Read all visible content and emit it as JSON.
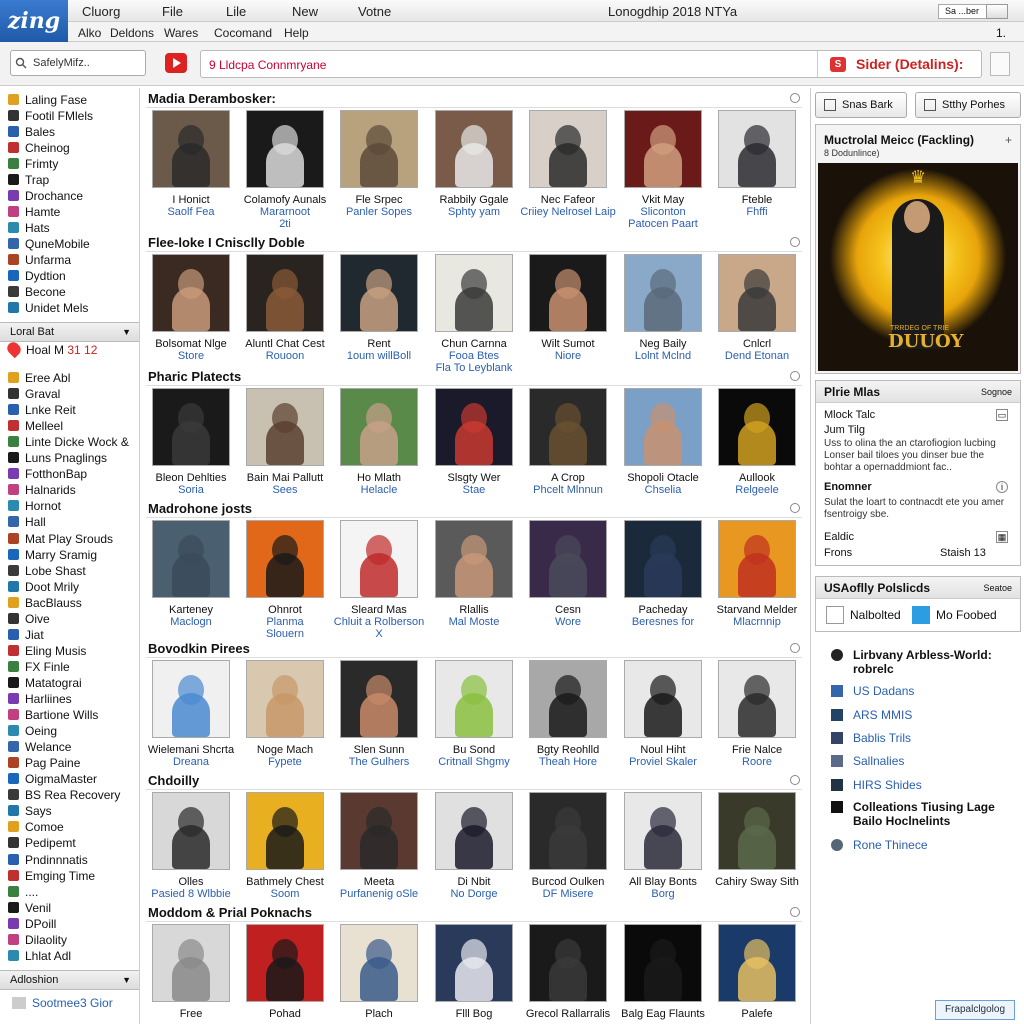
{
  "app": {
    "logo": "zing",
    "window_title": "Lonogdhip 2018 NTYa"
  },
  "titlebar": {
    "menus": [
      "Cluorg",
      "File",
      "Lile",
      "New",
      "Votne"
    ],
    "search_value": "Sa ...ber"
  },
  "menubar": {
    "items": [
      "Alko",
      "Deldons",
      "Wares",
      "Cocomand",
      "Help"
    ],
    "page_indicator": "1."
  },
  "toolbar": {
    "search_placeholder": "SafelyMifz..",
    "url": "9 Lldcpa Connmryane",
    "sider_label": "Sider (Detalins):"
  },
  "sidebar": {
    "items_a": [
      "Laling Fase",
      "Footil FMlels",
      "Bales",
      "Cheinog",
      "Frimty",
      "Trap",
      "Drochance",
      "Hamte",
      "Hats",
      "QuneMobile",
      "Unfarma",
      "Dydtion",
      "Becone",
      "Unidet Mels"
    ],
    "local_header": "Loral Bat",
    "hot_label": "Hoal M",
    "hot_count": "31 12",
    "items_b": [
      "Eree Abl",
      "Graval",
      "Lnke Reit",
      "Melleel",
      "Linte Dicke Wock &",
      "Luns Pnaglings",
      "FotthonBap",
      "Halnarids",
      "Hornot",
      "Hall",
      "Mat Play Srouds",
      "Marry Sramig",
      "Lobe Shast",
      "Doot Mrily",
      "BacBlauss",
      "Oive",
      "Jiat",
      "Eling Musis",
      "FX Finle",
      "Matatograi",
      "Harliines",
      "Bartione Wills",
      "Oeing",
      "Welance",
      "Pag Paine",
      "OigmaMaster",
      "BS Rea Recovery",
      "Says",
      "Comoe",
      "Pedipemt",
      "Pndinnnatis",
      "Emging Time",
      "....",
      "Venil",
      "DPoill",
      "Dilaolity",
      "Lhlat Adl"
    ],
    "bottom_header": "Adloshion",
    "footer_label": "Sootmee3 Gior",
    "colors": [
      "#e0a020",
      "#333333",
      "#2a5fb0",
      "#c03030",
      "#3a8040",
      "#1a1a1a",
      "#7a3ab0",
      "#c04080",
      "#2a8ab0",
      "#3366aa",
      "#aa4422",
      "#1a66bb",
      "#3a3a3a",
      "#2277aa"
    ]
  },
  "main": {
    "sections": [
      {
        "title": "Madia Derambosker:",
        "items": [
          {
            "t1": "I Honict",
            "t2": "Saolf Fea",
            "t3": "",
            "bg": "#6b5a4a",
            "fig": "#2a2a2a"
          },
          {
            "t1": "Colamofy Aunals",
            "t2": "Mararnoot",
            "t3": "2ti",
            "bg": "#1a1a1a",
            "fig": "#dcdcdc"
          },
          {
            "t1": "Fle Srpec",
            "t2": "Panler Sopes",
            "t3": "",
            "bg": "#b8a27e",
            "fig": "#5a4a38"
          },
          {
            "t1": "Rabbily Ggale",
            "t2": "Sphty yam",
            "t3": "",
            "bg": "#7a5a48",
            "fig": "#e8e8e8"
          },
          {
            "t1": "Nec Fafeor",
            "t2": "Criiey Nelrosel Laip",
            "t3": "",
            "bg": "#d8d0c8",
            "fig": "#2a2a2a"
          },
          {
            "t1": "Vkit May",
            "t2": "Sliconton",
            "t3": "Patocen Paart",
            "bg": "#6a1a18",
            "fig": "#d0a080"
          },
          {
            "t1": "Fteble",
            "t2": "Fhffi",
            "t3": "",
            "bg": "#e2e2e2",
            "fig": "#2a2a30"
          }
        ]
      },
      {
        "title": "Flee-loke I Cnisclly Doble",
        "items": [
          {
            "t1": "Bolsomat Nlge",
            "t2": "Store",
            "t3": "",
            "bg": "#3a2a22",
            "fig": "#c89a7a"
          },
          {
            "t1": "Aluntl Chat Cest",
            "t2": "Rouoon",
            "t3": "",
            "bg": "#2a2420",
            "fig": "#8a5a38"
          },
          {
            "t1": "Rent",
            "t2": "1oum willBoll",
            "t3": "",
            "bg": "#202830",
            "fig": "#c8a080"
          },
          {
            "t1": "Chun Carnna",
            "t2": "Fooa Btes",
            "t3": "Fla To Leyblank",
            "bg": "#e8e8e0",
            "fig": "#3a3a3a"
          },
          {
            "t1": "Wilt Sumot",
            "t2": "Niore",
            "t3": "",
            "bg": "#1a1a1a",
            "fig": "#c89070"
          },
          {
            "t1": "Neg Baily",
            "t2": "Lolnt Mclnd",
            "t3": "",
            "bg": "#8aa8c8",
            "fig": "#5a6a7a"
          },
          {
            "t1": "Cnlcrl",
            "t2": "Dend Etonan",
            "t3": "",
            "bg": "#c8a888",
            "fig": "#3a3a3a"
          }
        ]
      },
      {
        "title": "Pharic Platects",
        "items": [
          {
            "t1": "Bleon Dehlties",
            "t2": "Soria",
            "t3": "",
            "bg": "#1a1a1a",
            "fig": "#3a3a3a"
          },
          {
            "t1": "Bain Mai Pallutt",
            "t2": "Sees",
            "t3": "",
            "bg": "#c8c0b0",
            "fig": "#5a4030"
          },
          {
            "t1": "Ho Mlath",
            "t2": "Helacle",
            "t3": "",
            "bg": "#5a8a4a",
            "fig": "#c8a088"
          },
          {
            "t1": "Slsgty Wer",
            "t2": "Stae",
            "t3": "",
            "bg": "#1a1a2a",
            "fig": "#c83a30"
          },
          {
            "t1": "A Crop",
            "t2": "Phcelt Mlnnun",
            "t3": "",
            "bg": "#2a2a2a",
            "fig": "#6a5030"
          },
          {
            "t1": "Shopoli Otacle",
            "t2": "Chselia",
            "t3": "",
            "bg": "#7aa0c8",
            "fig": "#c89070"
          },
          {
            "t1": "Aullook",
            "t2": "Relgeele",
            "t3": "",
            "bg": "#0a0a0a",
            "fig": "#d0a020"
          }
        ]
      },
      {
        "title": "Madrohone josts",
        "items": [
          {
            "t1": "Karteney",
            "t2": "Maclogn",
            "t3": "",
            "bg": "#4a6070",
            "fig": "#3a4a5a"
          },
          {
            "t1": "Ohnrot",
            "t2": "Planma",
            "t3": "Slouern",
            "bg": "#e06818",
            "fig": "#1a1a1a"
          },
          {
            "t1": "Sleard Mas",
            "t2": "Chluit a Rolberson",
            "t3": "X",
            "bg": "#f4f4f4",
            "fig": "#c02a2a"
          },
          {
            "t1": "Rlallis",
            "t2": "Mal Moste",
            "t3": "",
            "bg": "#5a5a5a",
            "fig": "#c89878"
          },
          {
            "t1": "Cesn",
            "t2": "Wore",
            "t3": "",
            "bg": "#3a2a4a",
            "fig": "#4a4a5a"
          },
          {
            "t1": "Pacheday",
            "t2": "Beresnes for",
            "t3": "",
            "bg": "#1a2a3a",
            "fig": "#2a3a5a"
          },
          {
            "t1": "Starvand Melder",
            "t2": "Mlacrnnip",
            "t3": "",
            "bg": "#e89820",
            "fig": "#c03020"
          }
        ]
      },
      {
        "title": "Bovodkin Pirees",
        "items": [
          {
            "t1": "Wielemani Shcrta",
            "t2": "Dreana",
            "t3": "",
            "bg": "#f0f0f0",
            "fig": "#4a8ad0"
          },
          {
            "t1": "Noge Mach",
            "t2": "Fypete",
            "t3": "",
            "bg": "#d8c8b0",
            "fig": "#c89868"
          },
          {
            "t1": "Slen Sunn",
            "t2": "The Gulhers",
            "t3": "",
            "bg": "#2a2a2a",
            "fig": "#c88a68"
          },
          {
            "t1": "Bu Sond",
            "t2": "Critnall Shgmy",
            "t3": "",
            "bg": "#e8e8e8",
            "fig": "#8ac040"
          },
          {
            "t1": "Bgty Reohlld",
            "t2": "Theah Hore",
            "t3": "",
            "bg": "#a8a8a8",
            "fig": "#1a1a1a"
          },
          {
            "t1": "Noul Hiht",
            "t2": "Proviel Skaler",
            "t3": "",
            "bg": "#e8e8e8",
            "fig": "#1a1a1a"
          },
          {
            "t1": "Frie Nalce",
            "t2": "Roore",
            "t3": "",
            "bg": "#e8e8e8",
            "fig": "#2a2a2a"
          }
        ]
      },
      {
        "title": "Chdoilly",
        "items": [
          {
            "t1": "Olles",
            "t2": "Pasied 8 Wlbbie",
            "t3": "",
            "bg": "#d8d8d8",
            "fig": "#2a2a2a"
          },
          {
            "t1": "Bathmely Chest",
            "t2": "Soom",
            "t3": "",
            "bg": "#e8b020",
            "fig": "#1a1a1a"
          },
          {
            "t1": "Meeta",
            "t2": "Purfanenig oSle",
            "t3": "",
            "bg": "#5a3a30",
            "fig": "#2a2a2a"
          },
          {
            "t1": "Di Nbit",
            "t2": "No Dorge",
            "t3": "",
            "bg": "#e0e0e0",
            "fig": "#1a1a2a"
          },
          {
            "t1": "Burcod Oulken",
            "t2": "DF Misere",
            "t3": "",
            "bg": "#2a2a2a",
            "fig": "#3a3a3a"
          },
          {
            "t1": "All Blay Bonts",
            "t2": "Borg",
            "t3": "",
            "bg": "#e8e8e8",
            "fig": "#2a2a3a"
          },
          {
            "t1": "Cahiry Sway Sith",
            "t2": "",
            "t3": "",
            "bg": "#3a3a2a",
            "fig": "#5a6a4a"
          }
        ]
      },
      {
        "title": "Moddom & Prial Poknachs",
        "items": [
          {
            "t1": "Free",
            "t2": "",
            "t3": "",
            "bg": "#d8d8d8",
            "fig": "#8a8a8a"
          },
          {
            "t1": "Pohad",
            "t2": "",
            "t3": "",
            "bg": "#c02020",
            "fig": "#1a1a1a"
          },
          {
            "t1": "Plach",
            "t2": "",
            "t3": "",
            "bg": "#e8e0d0",
            "fig": "#3a5a8a"
          },
          {
            "t1": "Flll Bog",
            "t2": "",
            "t3": "",
            "bg": "#2a3a5a",
            "fig": "#e8e8f0"
          },
          {
            "t1": "Grecol Rallarralis",
            "t2": "",
            "t3": "",
            "bg": "#1a1a1a",
            "fig": "#3a3a3a"
          },
          {
            "t1": "Balg Eag Flaunts",
            "t2": "",
            "t3": "",
            "bg": "#0a0a0a",
            "fig": "#1a1a1a"
          },
          {
            "t1": "Palefe",
            "t2": "",
            "t3": "",
            "bg": "#1a3a6a",
            "fig": "#e8c060"
          }
        ]
      }
    ]
  },
  "right": {
    "btn1": "Snas Bark",
    "btn2": "Stthy Porhes",
    "featured_title": "Muctrolal Meicc (Fackling)",
    "featured_sub": "8 Dodunlince)",
    "featured_close": "+",
    "poster_title": "DUUOY",
    "poster_sub": "TRRDEG OF TRIE",
    "panel1_title": "Plrie Mlas",
    "panel1_right": "Sognoe",
    "p1_l1": "Mlock Talc",
    "p1_l2": "Jum Tilg",
    "p1_b1": "Uss to olina the an ctarofiogion lucbing Lonser bail tiloes you dinser bue the bohtar a opernaddmiont fac..",
    "p1_l3": "Enomner",
    "p1_b2": "Sulat the loart to contnacdt ete you amer fsentroigy sbe.",
    "p1_l4": "Ealdic",
    "p1_l5": "Frons",
    "p1_l5_right": "Staish 13",
    "panel2_title": "USAoflly Polslicds",
    "panel2_right": "Seatoe",
    "cb1": "Nalbolted",
    "cb2": "Mo Foobed",
    "links": [
      {
        "label": "Lirbvany Arbless-World: robrelc",
        "bold": true
      },
      {
        "label": "US Dadans",
        "bold": false
      },
      {
        "label": "ARS MMIS",
        "bold": false
      },
      {
        "label": "Bablis Trils",
        "bold": false
      },
      {
        "label": "Sallnalies",
        "bold": false
      },
      {
        "label": "HIRS Shides",
        "bold": false
      },
      {
        "label": "Colleations Tiusing Lage Bailo Hoclnelints",
        "bold": true
      },
      {
        "label": "Rone Thinece",
        "bold": false
      }
    ],
    "footer_button": "Frapalclgolog"
  }
}
